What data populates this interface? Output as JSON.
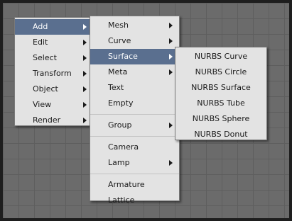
{
  "menu_level1": {
    "items": [
      {
        "label": "Add"
      },
      {
        "label": "Edit"
      },
      {
        "label": "Select"
      },
      {
        "label": "Transform"
      },
      {
        "label": "Object"
      },
      {
        "label": "View"
      },
      {
        "label": "Render"
      }
    ]
  },
  "menu_level2": {
    "items": [
      {
        "label": "Mesh"
      },
      {
        "label": "Curve"
      },
      {
        "label": "Surface"
      },
      {
        "label": "Meta"
      },
      {
        "label": "Text"
      },
      {
        "label": "Empty"
      },
      {
        "label": "Group"
      },
      {
        "label": "Camera"
      },
      {
        "label": "Lamp"
      },
      {
        "label": "Armature"
      },
      {
        "label": "Lattice"
      }
    ]
  },
  "menu_level3": {
    "items": [
      {
        "label": "NURBS Curve"
      },
      {
        "label": "NURBS Circle"
      },
      {
        "label": "NURBS Surface"
      },
      {
        "label": "NURBS Tube"
      },
      {
        "label": "NURBS Sphere"
      },
      {
        "label": "NURBS Donut"
      }
    ]
  },
  "colors": {
    "highlight": "#5a6f8f",
    "menu_bg": "#e3e3e3",
    "viewport_bg": "#6b6b6b"
  },
  "icons": [
    "submenu-arrow-icon"
  ]
}
